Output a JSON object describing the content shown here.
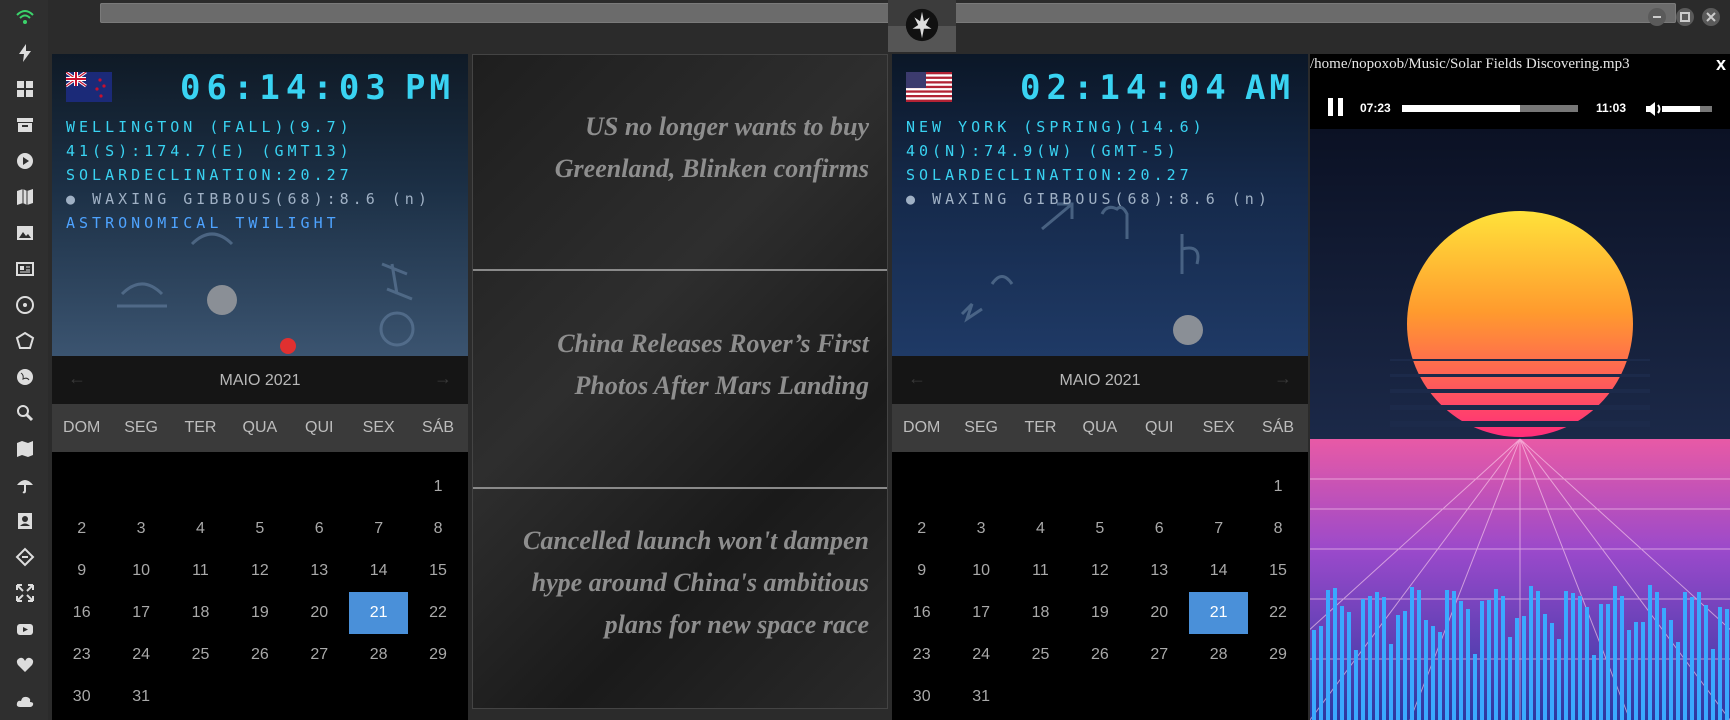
{
  "sidebar": {
    "icons": [
      "wifi-icon",
      "lightning-icon",
      "windows-icon",
      "archive-icon",
      "play-icon",
      "map-book-icon",
      "image-icon",
      "news-icon",
      "radiation-icon",
      "polygon-icon",
      "globe-icon",
      "search-icon",
      "map-icon",
      "umbrella-icon",
      "contact-icon",
      "tag-icon",
      "expand-icon",
      "youtube-icon",
      "heart-icon",
      "cloud-icon"
    ]
  },
  "clocks": [
    {
      "time": "06:14:03",
      "ampm": "PM",
      "line1": "WELLINGTON (FALL)(9.7)",
      "line2": "41(S):174.7(E) (GMT13)",
      "line3": "SOLARDECLINATION:20.27",
      "moon": "WAXING GIBBOUS(68):8.6",
      "moon_suffix": "(n)",
      "twilight": "ASTRONOMICAL TWILIGHT",
      "flag": "new-zealand-flag-icon"
    },
    {
      "time": "02:14:04",
      "ampm": "AM",
      "line1": "NEW YORK (SPRING)(14.6)",
      "line2": "40(N):74.9(W) (GMT-5)",
      "line3": "SOLARDECLINATION:20.27",
      "moon": "WAXING GIBBOUS(68):8.6",
      "moon_suffix": "(n)",
      "twilight": "",
      "flag": "usa-flag-icon"
    }
  ],
  "calendar": {
    "month": "MAIO 2021",
    "weekdays": [
      "DOM",
      "SEG",
      "TER",
      "QUA",
      "QUI",
      "SEX",
      "SÁB"
    ],
    "today": 21,
    "rows": [
      [
        "",
        "",
        "",
        "",
        "",
        "",
        "1"
      ],
      [
        "2",
        "3",
        "4",
        "5",
        "6",
        "7",
        "8"
      ],
      [
        "9",
        "10",
        "11",
        "12",
        "13",
        "14",
        "15"
      ],
      [
        "16",
        "17",
        "18",
        "19",
        "20",
        "21",
        "22"
      ],
      [
        "23",
        "24",
        "25",
        "26",
        "27",
        "28",
        "29"
      ],
      [
        "30",
        "31",
        "",
        "",
        "",
        "",
        ""
      ]
    ]
  },
  "news": [
    {
      "headline": "US no longer wants to buy Greenland, Blinken confirms"
    },
    {
      "headline": "China Releases Rover’s First Photos After Mars Landing"
    },
    {
      "headline": "Cancelled launch won't dampen hype around China's ambitious plans for new space race"
    }
  ],
  "player": {
    "path": "/home/nopoxob/Music/Solar Fields Discovering.mp3",
    "close": "x",
    "current_time": "07:23",
    "total_time": "11:03",
    "progress_fraction": 0.668,
    "volume_fraction": 0.75
  },
  "colors": {
    "clock_text": "#39d3f2",
    "today_highlight": "#4a90d9",
    "visualizer": "#3aa9ff"
  }
}
